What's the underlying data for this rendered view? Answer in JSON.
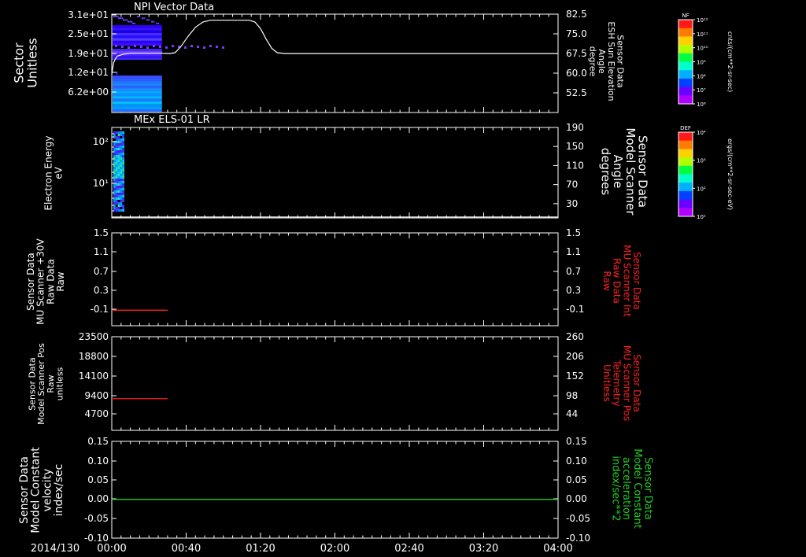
{
  "colors": {
    "white": "#ffffff",
    "red": "#ff2020",
    "green": "#22cc22",
    "background": "#000000"
  },
  "time_axis": {
    "date_label": "2014/130",
    "ticks": [
      "00:00",
      "00:40",
      "01:20",
      "02:00",
      "02:40",
      "03:20",
      "04:00"
    ],
    "tick_minutes": [
      0,
      40,
      80,
      120,
      160,
      200,
      240
    ],
    "range_minutes": [
      0,
      240
    ]
  },
  "chart_data": [
    {
      "type": "heatmap",
      "panel": "npi",
      "title": "NPI Vector Data",
      "ylabel": [
        "Sector",
        "Unitless"
      ],
      "yticks": [
        "3.1e+01",
        "2.5e+01",
        "1.9e+01",
        "1.2e+01",
        "6.2e+00"
      ],
      "ylabel2": [
        "Sensor Data",
        "ESH Sun Elevation",
        "Angle",
        "degree"
      ],
      "yticks2": [
        "82.5",
        "75.0",
        "67.5",
        "60.0",
        "52.5"
      ],
      "y2_range": [
        45,
        82.5
      ],
      "data_end_minutes": 27,
      "overlay_line": {
        "color": "white",
        "points": [
          [
            0,
            59.5
          ],
          [
            0.5,
            62
          ],
          [
            1,
            64
          ],
          [
            2,
            65.5
          ],
          [
            3,
            66.5
          ],
          [
            6,
            67.2
          ],
          [
            10,
            67.6
          ],
          [
            27,
            67.6
          ],
          [
            31,
            67.5
          ],
          [
            34,
            67.8
          ],
          [
            37,
            70
          ],
          [
            41,
            74
          ],
          [
            45,
            77.5
          ],
          [
            49,
            79.5
          ],
          [
            53,
            80.2
          ],
          [
            74,
            80.2
          ],
          [
            77,
            79.5
          ],
          [
            80,
            77
          ],
          [
            83,
            73
          ],
          [
            86,
            69.5
          ],
          [
            89,
            67.8
          ],
          [
            93,
            67.5
          ],
          [
            240,
            67.5
          ]
        ]
      },
      "colorbar": {
        "label": "NF",
        "unit": "cnts/(cm**2-sr-sec)",
        "ticks": [
          "10¹²",
          "10¹¹",
          "10¹⁰",
          "10⁹",
          "10⁸",
          "10⁷",
          "10⁶"
        ]
      }
    },
    {
      "type": "heatmap",
      "panel": "els",
      "title": "MEx ELS-01 LR",
      "ylabel": [
        "Electron Energy",
        "eV"
      ],
      "yticks": [
        "10²",
        "10¹"
      ],
      "ylabel2": [
        "Sensor Data",
        "Model Scanner",
        "Angle",
        "degrees"
      ],
      "yticks2": [
        "190",
        "150",
        "110",
        "70",
        "30"
      ],
      "y2_range": [
        0,
        190
      ],
      "data_end_minutes": 3,
      "overlay_line": {
        "color": "white",
        "points": [
          [
            0,
            2
          ],
          [
            240,
            2
          ]
        ]
      },
      "colorbar": {
        "label": "DEF",
        "unit": "ergs/(cm**2-sr-sec-eV)",
        "ticks": [
          "10⁴",
          "10³",
          "10²",
          "10¹"
        ]
      }
    },
    {
      "type": "line",
      "panel": "mu_raw",
      "ylabel": [
        "Sensor Data",
        "MU Scanner +30V",
        "Raw Data",
        "Raw"
      ],
      "yticks": [
        "1.5",
        "1.1",
        "0.7",
        "0.3",
        "-0.1"
      ],
      "yticks2": [
        "1.5",
        "1.1",
        "0.7",
        "0.3",
        "-0.1"
      ],
      "ylabel2": [
        "Sensor Data",
        "MU Scanner Int",
        "Raw Data",
        "Raw"
      ],
      "ylim": [
        -0.3,
        1.5
      ],
      "series": [
        {
          "color": "red",
          "points": [
            [
              0,
              0
            ],
            [
              30,
              0
            ]
          ]
        }
      ]
    },
    {
      "type": "line",
      "panel": "mu_pos",
      "ylabel": [
        "Sensor Data",
        "Model Scanner Pos",
        "Raw",
        "unitless"
      ],
      "yticks": [
        "23500",
        "18800",
        "14100",
        "9400",
        "4700"
      ],
      "yticks2": [
        "260",
        "206",
        "152",
        "98",
        "44"
      ],
      "ylabel2": [
        "Sensor Data",
        "MU Scanner Pos",
        "Telemetry",
        "Unitless"
      ],
      "ylim": [
        0,
        23500
      ],
      "series": [
        {
          "color": "red",
          "points": [
            [
              0,
              7950
            ],
            [
              30,
              7950
            ]
          ]
        }
      ]
    },
    {
      "type": "line",
      "panel": "model",
      "ylabel": [
        "Sensor Data",
        "Model Constant",
        "velocity",
        "index/sec"
      ],
      "yticks": [
        "0.15",
        "0.10",
        "0.05",
        "0.00",
        "-0.05",
        "-0.10"
      ],
      "yticks2": [
        "0.15",
        "0.10",
        "0.05",
        "0.00",
        "-0.05",
        "-0.10"
      ],
      "ylabel2": [
        "Sensor Data",
        "Model Constant",
        "acceleration",
        "index/sec**2"
      ],
      "ylim": [
        -0.1,
        0.15
      ],
      "series": [
        {
          "color": "green",
          "points": [
            [
              0,
              0
            ],
            [
              240,
              0
            ]
          ]
        }
      ]
    }
  ]
}
